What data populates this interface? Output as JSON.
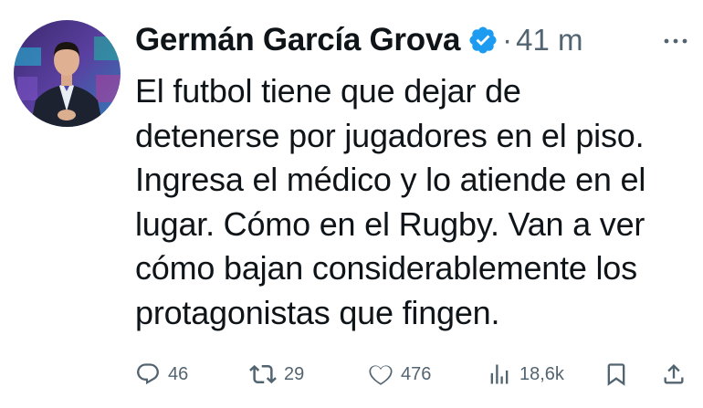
{
  "tweet": {
    "author_name": "Germán García Grova",
    "separator": "·",
    "time": "41 m",
    "text_lines": [
      "El futbol tiene que dejar de",
      "detenerse por jugadores en el piso.",
      "Ingresa el médico y lo atiende en el",
      "lugar. Cómo en el Rugby. Van a ver",
      "cómo bajan considerablemente los",
      "protagonistas que fingen."
    ],
    "stats": {
      "replies": "46",
      "retweets": "29",
      "likes": "476",
      "views": "18,6k"
    }
  },
  "icons": {
    "verified": "verified-badge-icon",
    "more": "more-options-icon",
    "reply": "reply-icon",
    "retweet": "retweet-icon",
    "like": "heart-icon",
    "views": "views-chart-icon",
    "bookmark": "bookmark-icon",
    "share": "share-icon"
  },
  "colors": {
    "text": "#0f1419",
    "secondary": "#536471",
    "verified": "#1d9bf0",
    "background": "#ffffff"
  }
}
